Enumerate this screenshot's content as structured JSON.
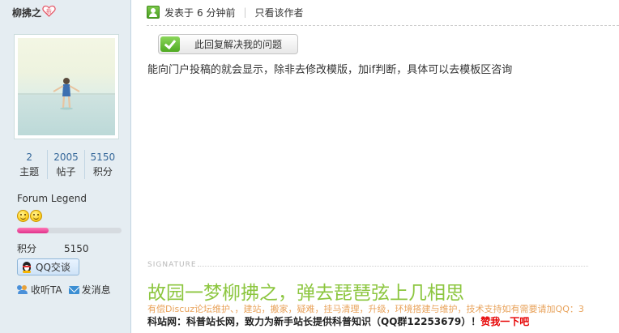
{
  "author": {
    "name": "柳拂之",
    "stats": [
      {
        "value": "2",
        "label": "主题"
      },
      {
        "value": "2005",
        "label": "帖子"
      },
      {
        "value": "5150",
        "label": "积分"
      }
    ],
    "group": "Forum Legend",
    "credit_progress": 0.3,
    "credit_label": "积分",
    "credit_value": "5150",
    "qq_label": "QQ交谈",
    "follow_label": "收听TA",
    "message_label": "发消息"
  },
  "post": {
    "posted_prefix": "发表于",
    "posted_time": "6 分钟前",
    "only_author": "只看该作者",
    "solve_button": "此回复解决我的问题",
    "body": "能向门户投稿的就会显示，除非去修改模版，加if判断，具体可以去模板区咨询"
  },
  "signature": {
    "label": "SIGNATURE",
    "title": "故园一梦柳拂之，弹去琵琶弦上几相思",
    "subtitle": "有偿Discuz论坛维护、，建站，搬家，疑难，挂马清理，升级，环境搭建与维护，技术支持如有需要请加QQ：3",
    "bottom_text": "科站网：科普站长网，致力为新手站长提供科普知识（QQ群12253679）！",
    "bottom_link": "赞我一下吧"
  },
  "colors": {
    "sidebar_bg": "#e5edf2",
    "signature_title": "#8cc63f",
    "signature_subtitle": "#e8a25a",
    "link_red": "#e60000"
  }
}
